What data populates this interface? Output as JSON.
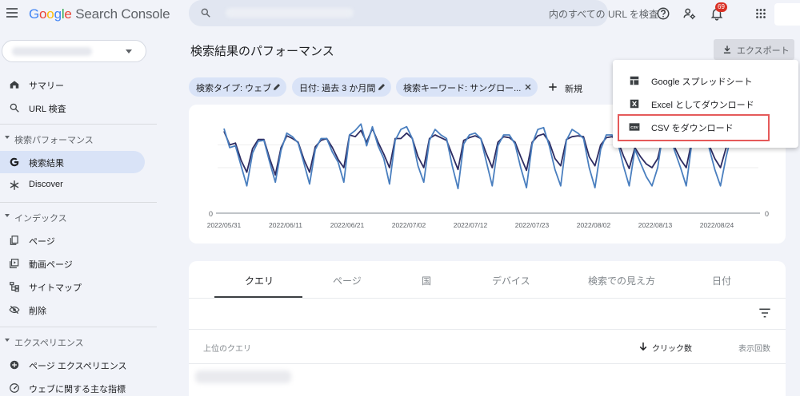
{
  "app": {
    "logo_google": "Google",
    "logo_product": "Search Console",
    "search_placeholder": "内のすべての URL を検査",
    "notification_count": "69"
  },
  "sidebar": {
    "items": [
      {
        "label": "サマリー",
        "icon": "home-icon"
      },
      {
        "label": "URL 検査",
        "icon": "search-icon"
      }
    ],
    "section_performance": "検索パフォーマンス",
    "performance_items": [
      {
        "label": "検索結果",
        "icon": "google-g-icon",
        "active": true
      },
      {
        "label": "Discover",
        "icon": "asterisk-icon"
      }
    ],
    "section_index": "インデックス",
    "index_items": [
      {
        "label": "ページ",
        "icon": "pages-icon"
      },
      {
        "label": "動画ページ",
        "icon": "video-page-icon"
      },
      {
        "label": "サイトマップ",
        "icon": "sitemap-icon"
      },
      {
        "label": "削除",
        "icon": "removal-icon"
      }
    ],
    "section_experience": "エクスペリエンス",
    "experience_items": [
      {
        "label": "ページ エクスペリエンス",
        "icon": "plus-circle-icon"
      },
      {
        "label": "ウェブに関する主な指標",
        "icon": "gauge-icon"
      }
    ]
  },
  "main": {
    "title": "検索結果のパフォーマンス",
    "export_label": "エクスポート",
    "filters": [
      {
        "label": "検索タイプ: ウェブ"
      },
      {
        "label": "日付: 過去 3 か月間"
      },
      {
        "label": "検索キーワード: サングロー..."
      }
    ],
    "new_filter_label": "新規",
    "tabs": [
      "クエリ",
      "ページ",
      "国",
      "デバイス",
      "検索での見え方",
      "日付"
    ],
    "table_headers": {
      "query": "上位のクエリ",
      "clicks": "クリック数",
      "impressions": "表示回数"
    }
  },
  "export_menu": {
    "items": [
      {
        "label": "Google スプレッドシート",
        "icon": "sheets-icon"
      },
      {
        "label": "Excel としてダウンロード",
        "icon": "excel-icon"
      },
      {
        "label": "CSV をダウンロード",
        "icon": "csv-icon"
      }
    ]
  },
  "chart_data": {
    "type": "line",
    "x_tick_labels": [
      "2022/05/31",
      "2022/06/11",
      "2022/06/21",
      "2022/07/02",
      "2022/07/12",
      "2022/07/23",
      "2022/08/02",
      "2022/08/13",
      "2022/08/24"
    ],
    "y_left_label": "0",
    "y_right_label": "0",
    "ylim": [
      0,
      1
    ],
    "colors": {
      "clicks": "#2d2c62",
      "impressions": "#4a7fbf"
    },
    "series": [
      {
        "values": [
          0.9,
          0.75,
          0.77,
          0.58,
          0.45,
          0.71,
          0.81,
          0.81,
          0.6,
          0.42,
          0.72,
          0.85,
          0.82,
          0.78,
          0.59,
          0.45,
          0.73,
          0.8,
          0.82,
          0.72,
          0.59,
          0.5,
          0.86,
          0.84,
          0.91,
          0.78,
          0.93,
          0.78,
          0.65,
          0.5,
          0.82,
          0.82,
          0.88,
          0.82,
          0.62,
          0.5,
          0.82,
          0.86,
          0.83,
          0.8,
          0.64,
          0.48,
          0.8,
          0.83,
          0.85,
          0.82,
          0.65,
          0.5,
          0.78,
          0.84,
          0.83,
          0.78,
          0.62,
          0.47,
          0.78,
          0.85,
          0.87,
          0.78,
          0.6,
          0.52,
          0.81,
          0.84,
          0.85,
          0.84,
          0.62,
          0.52,
          0.75,
          0.83,
          0.84,
          0.8,
          0.63,
          0.49,
          0.72,
          0.62,
          0.54,
          0.5,
          0.6,
          0.86,
          0.82,
          0.72,
          0.59,
          0.5,
          0.8,
          0.85,
          0.84,
          0.75,
          0.6,
          0.5,
          0.72,
          0.84,
          0.78
        ]
      },
      {
        "values": [
          0.93,
          0.72,
          0.74,
          0.52,
          0.3,
          0.66,
          0.79,
          0.8,
          0.56,
          0.34,
          0.69,
          0.88,
          0.84,
          0.77,
          0.55,
          0.32,
          0.7,
          0.82,
          0.82,
          0.67,
          0.56,
          0.34,
          0.86,
          0.91,
          0.98,
          0.74,
          0.95,
          0.74,
          0.6,
          0.32,
          0.8,
          0.92,
          0.95,
          0.82,
          0.52,
          0.34,
          0.8,
          0.92,
          0.86,
          0.82,
          0.52,
          0.27,
          0.76,
          0.86,
          0.88,
          0.82,
          0.56,
          0.3,
          0.74,
          0.86,
          0.86,
          0.76,
          0.5,
          0.28,
          0.76,
          0.92,
          0.94,
          0.74,
          0.48,
          0.3,
          0.8,
          0.92,
          0.88,
          0.82,
          0.5,
          0.28,
          0.7,
          0.86,
          0.86,
          0.78,
          0.52,
          0.3,
          0.7,
          0.55,
          0.4,
          0.3,
          0.5,
          0.92,
          0.88,
          0.68,
          0.5,
          0.3,
          0.78,
          0.88,
          0.88,
          0.72,
          0.48,
          0.3,
          0.62,
          0.88,
          0.78
        ]
      }
    ]
  }
}
